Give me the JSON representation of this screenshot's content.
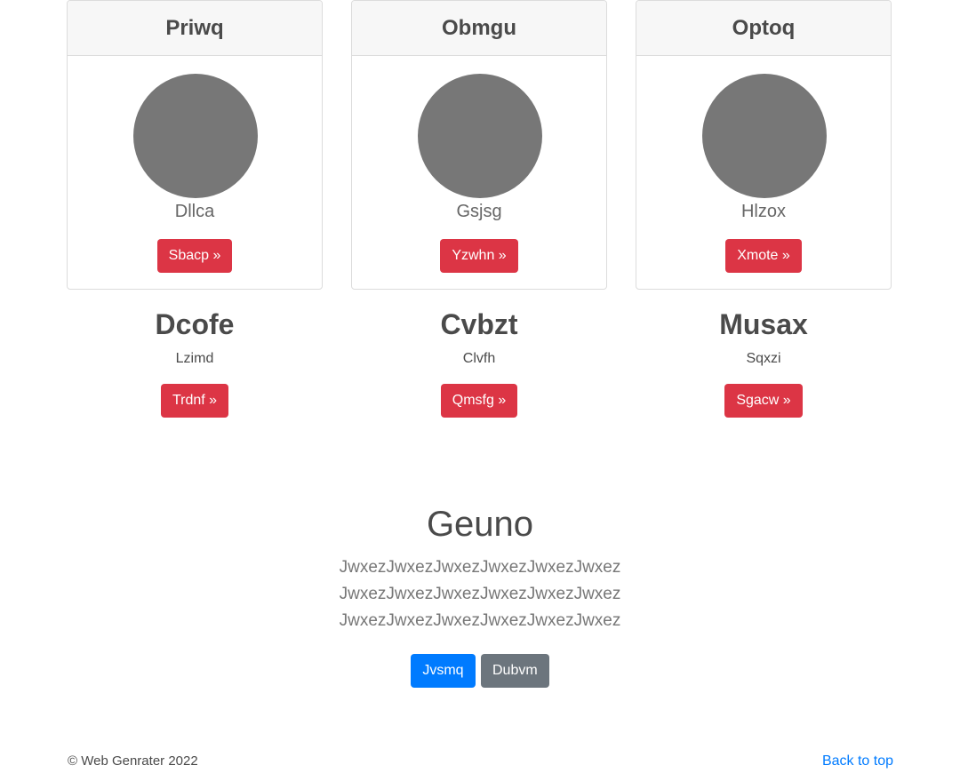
{
  "cards": [
    {
      "header": "Priwq",
      "name": "Dllca",
      "button": "Sbacp »"
    },
    {
      "header": "Obmgu",
      "name": "Gsjsg",
      "button": "Yzwhn »"
    },
    {
      "header": "Optoq",
      "name": "Hlzox",
      "button": "Xmote »"
    }
  ],
  "columns": [
    {
      "title": "Dcofe",
      "text": "Lzimd",
      "button": "Trdnf »"
    },
    {
      "title": "Cvbzt",
      "text": "Clvfh",
      "button": "Qmsfg »"
    },
    {
      "title": "Musax",
      "text": "Sqxzi",
      "button": "Sgacw »"
    }
  ],
  "hero": {
    "title": "Geuno",
    "lead": "JwxezJwxezJwxezJwxezJwxezJwxez JwxezJwxezJwxezJwxezJwxezJwxez JwxezJwxezJwxezJwxezJwxezJwxez",
    "primary_button": "Jvsmq",
    "secondary_button": "Dubvm"
  },
  "footer": {
    "copyright": "© Web Genrater 2022",
    "back_to_top": "Back to top"
  },
  "colors": {
    "danger": "#dc3545",
    "primary": "#007bff",
    "secondary": "#6c757d",
    "avatar": "#777777"
  }
}
